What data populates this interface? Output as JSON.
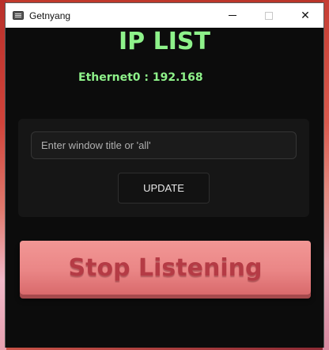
{
  "window": {
    "title": "Getnyang",
    "controls": {
      "minimize": "minimize",
      "maximize": "maximize",
      "close": "✕"
    }
  },
  "main": {
    "heading": "IP LIST",
    "ip_entries": [
      {
        "label": "Ethernet0 : ",
        "value": "192.168"
      }
    ]
  },
  "panel": {
    "window_input": {
      "value": "",
      "placeholder": "Enter window title or 'all'"
    },
    "update_label": "UPDATE"
  },
  "stop_button_label": "Stop Listening",
  "colors": {
    "accent_green": "#8ef28a",
    "stop_button": "#ea8686",
    "stop_text": "#b53b45",
    "background": "#0c0c0c"
  }
}
